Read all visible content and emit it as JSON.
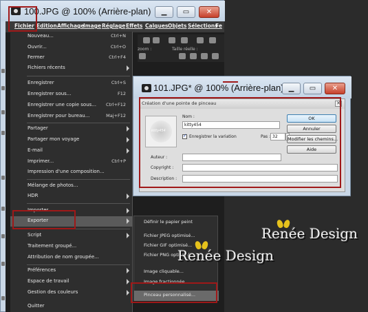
{
  "window1": {
    "title": "100.JPG @ 100% (Arrière-plan)"
  },
  "menubar": [
    "Fichier",
    "Edition",
    "Affichage",
    "Image",
    "Réglage",
    "Effets",
    "Calques",
    "Objets",
    "Sélections",
    "Fe"
  ],
  "toolbar": {
    "zoom_label": "zoom :",
    "actual_size_label": "Taille réelle :"
  },
  "file_menu": [
    {
      "label": "Nouveau...",
      "shortcut": "Ctrl+N"
    },
    {
      "label": "Ouvrir...",
      "shortcut": "Ctrl+O"
    },
    {
      "label": "Fermer",
      "shortcut": "Ctrl+F4"
    },
    {
      "label": "Fichiers récents",
      "submenu": true
    },
    {
      "label": "Enregistrer",
      "shortcut": "Ctrl+S"
    },
    {
      "label": "Enregistrer sous...",
      "shortcut": "F12"
    },
    {
      "label": "Enregistrer une copie sous...",
      "shortcut": "Ctrl+F12"
    },
    {
      "label": "Enregistrer pour bureau...",
      "shortcut": "Maj+F12"
    },
    {
      "label": "Partager",
      "submenu": true
    },
    {
      "label": "Partager mon voyage",
      "submenu": true
    },
    {
      "label": "E-mail",
      "submenu": true
    },
    {
      "label": "Imprimer...",
      "shortcut": "Ctrl+P"
    },
    {
      "label": "Impression d'une composition..."
    },
    {
      "label": "Mélange de photos..."
    },
    {
      "label": "HDR",
      "submenu": true
    },
    {
      "label": "Importer",
      "submenu": true
    },
    {
      "label": "Exporter",
      "submenu": true
    },
    {
      "label": "Script",
      "submenu": true
    },
    {
      "label": "Traitement groupé..."
    },
    {
      "label": "Attribution de nom groupée..."
    },
    {
      "label": "Préférences",
      "submenu": true
    },
    {
      "label": "Espace de travail",
      "submenu": true
    },
    {
      "label": "Gestion des couleurs",
      "submenu": true
    },
    {
      "label": "Quitter"
    }
  ],
  "export_submenu": [
    "Définir le papier peint",
    "Fichier JPEG optimisé...",
    "Fichier GIF optimisé...",
    "Fichier PNG optimisé...",
    "Image cliquable...",
    "Image fractionnée...",
    "Pinceau personnalisé..."
  ],
  "window2": {
    "title": "101.JPG* @ 100% (Arrière-plan)"
  },
  "dialog": {
    "title": "Création d'une pointe de pinceau",
    "preview_text": "kitty454",
    "name_label": "Nom :",
    "name_value": "kitty454",
    "save_variation_label": "Enregistrer la variation",
    "step_label": "Pas :",
    "step_value": "32",
    "author_label": "Auteur :",
    "copyright_label": "Copyright :",
    "description_label": "Description :",
    "ok_label": "OK",
    "cancel_label": "Annuler",
    "edit_paths_label": "Modifier les chemins...",
    "help_label": "Aide"
  },
  "watermark": "Renée Design",
  "colors": {
    "highlight_border": "#a01818",
    "menu_bg": "#2e2e2e",
    "watermark_wing": "#e6c21c"
  }
}
